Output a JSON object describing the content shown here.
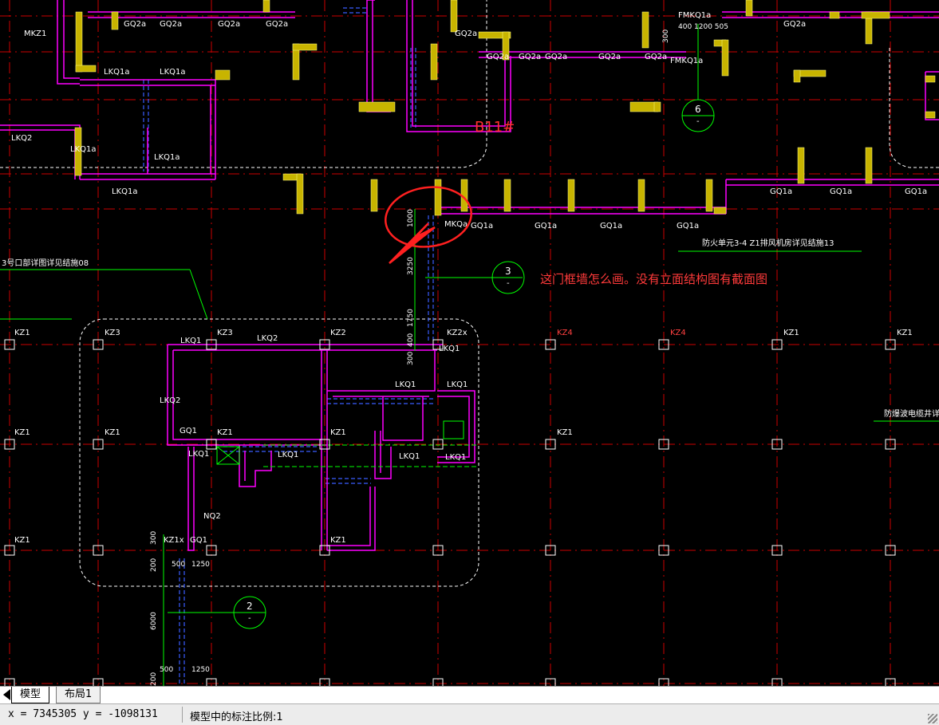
{
  "drawing": {
    "question_text": "这门框墙怎么画。没有立面结构图有截面图",
    "b_label": "B11#",
    "note_top_right": "防火单元3-4 Z1排风机房详见结施13",
    "note_left": "3号口部详图详见结施08",
    "note_right": "防爆波电缆井详",
    "circle_numbers": [
      "6",
      "3",
      "2"
    ],
    "circle_sub": "-",
    "column_labels": [
      "KZ1",
      "KZ3",
      "KZ3",
      "KZ2",
      "KZ2x",
      "KZ4",
      "KZ4",
      "KZ1",
      "KZ1",
      "KZ1",
      "KZ1",
      "KZ1",
      "KZ1",
      "KZ1",
      "KZ1",
      "KZ1x",
      "KZ1"
    ],
    "wall_labels": [
      "GQ2a",
      "GQ2a",
      "GQ2a",
      "GQ2a",
      "GQ2a",
      "GQ2a",
      "GQ2a",
      "GQ2a",
      "GQ2a",
      "GQ2a",
      "GQ2a",
      "LKQ1a",
      "LKQ1a",
      "LKQ2",
      "LKQ1a",
      "LKQ1a",
      "LKQ1a",
      "GQ1a",
      "GQ1a",
      "GQ1a",
      "GQ1a",
      "GQ1a",
      "GQ1a",
      "GQ1a",
      "MKQa",
      "LKQ1",
      "LKQ2",
      "LKQ2",
      "LKQ1",
      "LKQ1",
      "LKQ1",
      "LKQ1",
      "LKQ1",
      "LKQ1",
      "LKQ1",
      "GQ1",
      "GQ1",
      "NQ2",
      "MKZ1",
      "FMKQ1a",
      "FMKQ1a"
    ],
    "dims": [
      "1000",
      "3250",
      "1750",
      "400",
      "300",
      "300",
      "200",
      "500",
      "1250",
      "6000",
      "500",
      "1250",
      "200",
      "400 1200 505",
      "300"
    ],
    "colors": {
      "background": "#000000",
      "wall": "#ff00ff",
      "column_fill": "#c8b400",
      "grid": "#cc0000",
      "dim": "#00ff00",
      "dashed": "#3a5cff",
      "text": "#ffffff",
      "annotation": "#ff3a3a"
    }
  },
  "tabs": {
    "model": "模型",
    "layout": "布局1"
  },
  "status": {
    "coords": "x = 7345305 y = -1098131",
    "scale_text": "模型中的标注比例:1"
  }
}
